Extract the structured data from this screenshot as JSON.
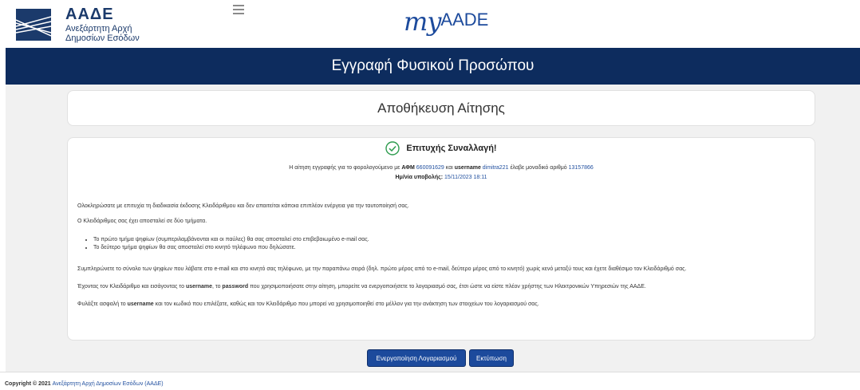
{
  "header": {
    "logo_acronym": "ΑΑΔΕ",
    "logo_line1": "Ανεξάρτητη Αρχή",
    "logo_line2": "Δημοσίων Εσόδων",
    "brand_my": "my",
    "brand_aade": "AADE"
  },
  "banner": {
    "title": "Εγγραφή Φυσικού Προσώπου"
  },
  "section_title": "Αποθήκευση Αίτησης",
  "success": {
    "title": "Επιτυχής Συναλλαγή!",
    "line1_prefix": "Η αίτηση εγγραφής για το φορολογούμενο με",
    "afm_label": "ΑΦΜ",
    "afm_value": "660091629",
    "and": "και",
    "username_label": "username",
    "username_value": "dimitra221",
    "line1_mid": "έλαβε μοναδικό αριθμό",
    "app_number": "13157866",
    "date_label": "Ημ/νία υποβολής:",
    "date_value": "15/11/2023 18:11"
  },
  "paragraphs": {
    "p1": "Ολοκληρώσατε με επιτυχία τη διαδικασία έκδοσης Κλειδάριθμου και δεν απαιτείται κάποια επιπλέον ενέργεια για την ταυτοποίησή σας.",
    "p2": "Ο Κλειδάριθμος σας έχει αποσταλεί σε δύο τμήματα.",
    "bullet1": "Το πρώτο τμήμα ψηφίων (συμπεριλαμβάνονται και οι παύλες) θα σας αποσταλεί στο επιβεβαιωμένο e-mail σας.",
    "bullet2": "Το δεύτερο τμήμα ψηφίων θα σας αποσταλεί στο κινητό τηλέφωνο που δηλώσατε.",
    "p3": "Συμπληρώνετε το σύνολο των ψηφίων που λάβατε στο e-mail και στο κινητό σας τηλέφωνο, με την παραπάνω σειρά (δηλ. πρώτο μέρος από το e-mail, δεύτερο μέρος από το κινητό) χωρίς κενό μεταξύ τους και έχετε διαθέσιμο τον Κλειδάριθμό σας.",
    "p4_a": "Έχοντας τον Κλειδάριθμο και εισάγοντας το",
    "p4_username": "username",
    "p4_b": ", το",
    "p4_password": "password",
    "p4_c": "που χρησιμοποιήσατε στην αίτηση, μπορείτε να ενεργοποιήσετε το λογαριασμό σας, έτσι ώστε να είστε πλέον χρήστης των Ηλεκτρονικών Υπηρεσιών της ΑΑΔΕ.",
    "p5_a": "Φυλάξτε ασφαλή το",
    "p5_username": "username",
    "p5_b": "και τον κωδικό που επιλέξατε, καθώς και τον Κλειδάριθμο που μπορεί να χρησιμοποιηθεί στο μέλλον για την ανάκτηση των στοιχείων του λογαριασμού σας."
  },
  "buttons": {
    "activate": "Ενεργοποίηση Λογαριασμού",
    "print": "Εκτύπωση"
  },
  "footer": {
    "copyright": "Copyright © 2021",
    "link": "Ανεξάρτητη Αρχή Δημοσίων Εσόδων (ΑΑΔΕ)"
  },
  "colors": {
    "banner": "#0d2c5e",
    "accent": "#1c4a9c",
    "success": "#2e9c4f"
  }
}
